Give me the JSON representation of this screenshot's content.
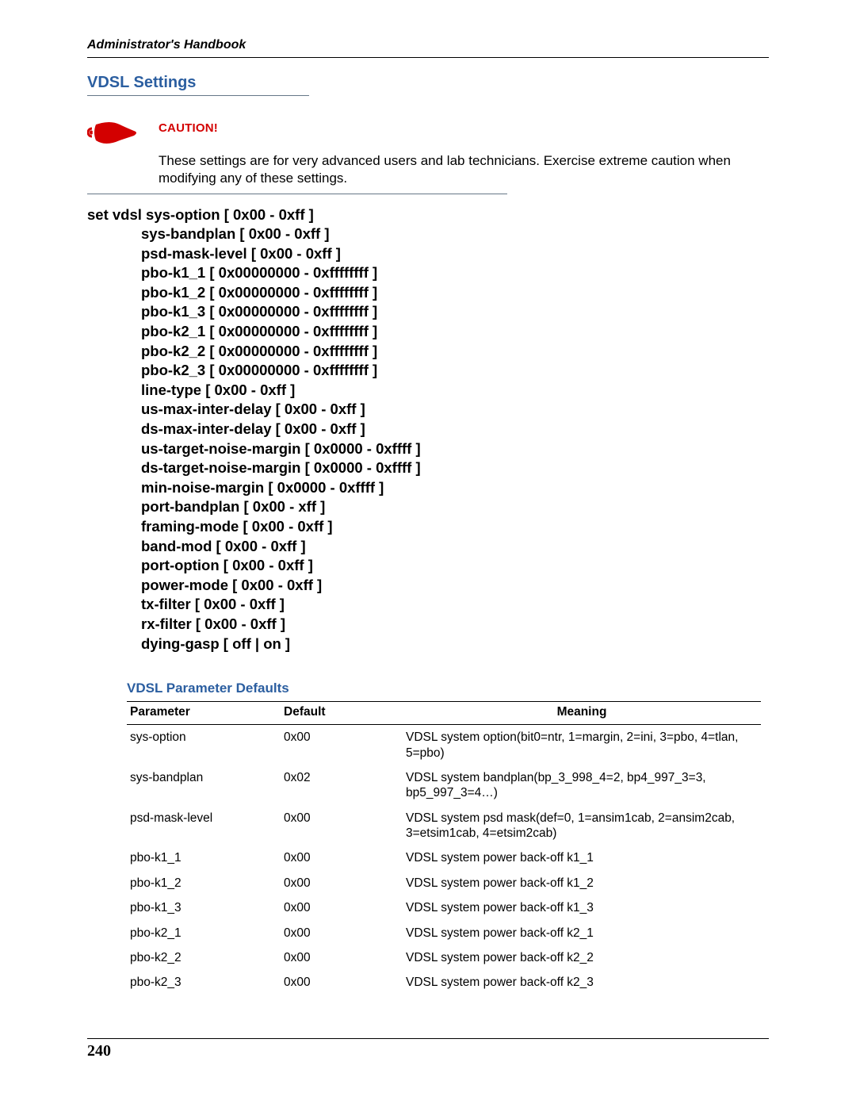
{
  "running_head": "Administrator's Handbook",
  "section_title": "VDSL Settings",
  "caution": {
    "label": "CAUTION!",
    "body": "These settings are for very advanced users and lab technicians. Exercise extreme caution when modifying any of these settings."
  },
  "command_lines": [
    "set vdsl sys-option [ 0x00 - 0xff ]",
    "sys-bandplan [ 0x00 - 0xff ]",
    "psd-mask-level [ 0x00 - 0xff ]",
    "pbo-k1_1 [ 0x00000000 - 0xffffffff ]",
    "pbo-k1_2 [ 0x00000000 - 0xffffffff ]",
    "pbo-k1_3 [ 0x00000000 - 0xffffffff ]",
    "pbo-k2_1 [ 0x00000000 - 0xffffffff ]",
    "pbo-k2_2 [ 0x00000000 - 0xffffffff ]",
    "pbo-k2_3 [ 0x00000000 - 0xffffffff ]",
    "line-type [ 0x00 - 0xff ]",
    "us-max-inter-delay [ 0x00 - 0xff ]",
    "ds-max-inter-delay [ 0x00 - 0xff ]",
    "us-target-noise-margin [ 0x0000 - 0xffff ]",
    "ds-target-noise-margin [ 0x0000 - 0xffff ]",
    "min-noise-margin [ 0x0000 - 0xffff ]",
    "port-bandplan [ 0x00 - xff ]",
    "framing-mode [ 0x00 - 0xff ]",
    "band-mod [ 0x00 - 0xff ]",
    "port-option [ 0x00 - 0xff ]",
    "power-mode [ 0x00 - 0xff ]",
    "tx-filter [ 0x00 - 0xff ]",
    "rx-filter [ 0x00 - 0xff ]",
    "dying-gasp [ off | on ]"
  ],
  "defaults": {
    "heading": "VDSL Parameter Defaults",
    "columns": {
      "param": "Parameter",
      "def": "Default",
      "mean": "Meaning"
    },
    "rows": [
      {
        "param": "sys-option",
        "def": "0x00",
        "mean": "VDSL system option(bit0=ntr, 1=margin, 2=ini, 3=pbo, 4=tlan, 5=pbo)"
      },
      {
        "param": "sys-bandplan",
        "def": "0x02",
        "mean": "VDSL system bandplan(bp_3_998_4=2, bp4_997_3=3, bp5_997_3=4…)"
      },
      {
        "param": "psd-mask-level",
        "def": "0x00",
        "mean": "VDSL system psd mask(def=0, 1=ansim1cab, 2=ansim2cab, 3=etsim1cab, 4=etsim2cab)"
      },
      {
        "param": "pbo-k1_1",
        "def": "0x00",
        "mean": "VDSL system power back-off k1_1"
      },
      {
        "param": "pbo-k1_2",
        "def": "0x00",
        "mean": "VDSL system power back-off k1_2"
      },
      {
        "param": "pbo-k1_3",
        "def": "0x00",
        "mean": "VDSL system power back-off k1_3"
      },
      {
        "param": "pbo-k2_1",
        "def": "0x00",
        "mean": "VDSL system power back-off k2_1"
      },
      {
        "param": "pbo-k2_2",
        "def": "0x00",
        "mean": "VDSL system power back-off k2_2"
      },
      {
        "param": "pbo-k2_3",
        "def": "0x00",
        "mean": "VDSL system power back-off k2_3"
      }
    ]
  },
  "page_number": "240"
}
